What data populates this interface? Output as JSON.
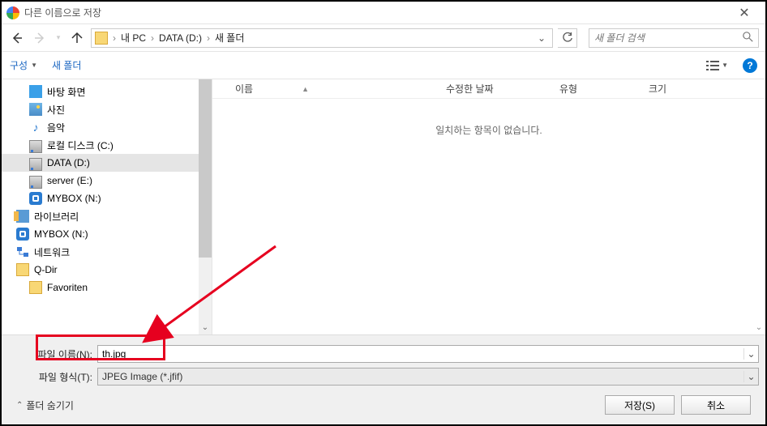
{
  "title": "다른 이름으로 저장",
  "breadcrumbs": {
    "root": "내 PC",
    "drive": "DATA (D:)",
    "folder": "새 폴더"
  },
  "search": {
    "placeholder": "새 폴더 검색"
  },
  "toolbar": {
    "organize": "구성",
    "newfolder": "새 폴더"
  },
  "tree": {
    "desktop": "바탕 화면",
    "pictures": "사진",
    "music": "음악",
    "localdisk": "로컬 디스크 (C:)",
    "datad": "DATA (D:)",
    "servere": "server (E:)",
    "myboxn": "MYBOX (N:)",
    "libraries": "라이브러리",
    "myboxn2": "MYBOX (N:)",
    "network": "네트워크",
    "qdir": "Q-Dir",
    "favoriten": "Favoriten"
  },
  "columns": {
    "name": "이름",
    "date": "수정한 날짜",
    "type": "유형",
    "size": "크기"
  },
  "empty_msg": "일치하는 항목이 없습니다.",
  "filename_label": "파일 이름(N):",
  "filetype_label": "파일 형식(T):",
  "filename_value": "th.jpg",
  "filetype_value": "JPEG Image (*.jfif)",
  "hide_folders": "폴더 숨기기",
  "save_btn": "저장(S)",
  "cancel_btn": "취소"
}
